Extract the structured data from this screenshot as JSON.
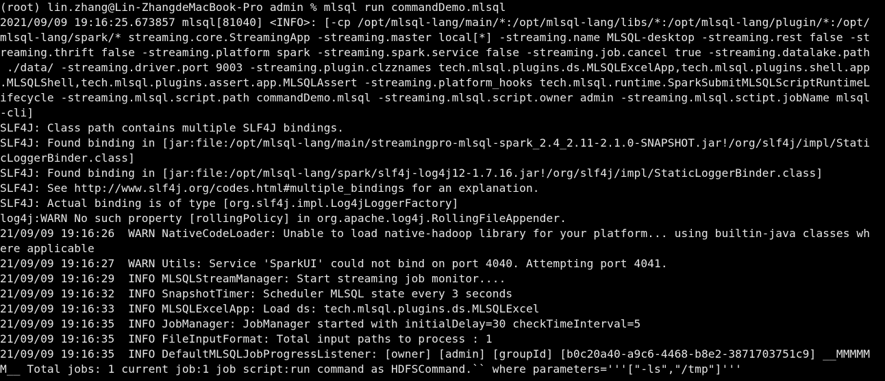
{
  "terminal": {
    "lines": [
      "(root) lin.zhang@Lin-ZhangdeMacBook-Pro admin % mlsql run commandDemo.mlsql",
      "2021/09/09 19:16:25.673857 mlsql[81040] <INFO>: [-cp /opt/mlsql-lang/main/*:/opt/mlsql-lang/libs/*:/opt/mlsql-lang/plugin/*:/opt/",
      "mlsql-lang/spark/* streaming.core.StreamingApp -streaming.master local[*] -streaming.name MLSQL-desktop -streaming.rest false -st",
      "reaming.thrift false -streaming.platform spark -streaming.spark.service false -streaming.job.cancel true -streaming.datalake.path",
      " ./data/ -streaming.driver.port 9003 -streaming.plugin.clzznames tech.mlsql.plugins.ds.MLSQLExcelApp,tech.mlsql.plugins.shell.app",
      ".MLSQLShell,tech.mlsql.plugins.assert.app.MLSQLAssert -streaming.platform_hooks tech.mlsql.runtime.SparkSubmitMLSQLScriptRuntimeL",
      "ifecycle -streaming.mlsql.script.path commandDemo.mlsql -streaming.mlsql.script.owner admin -streaming.mlsql.sctipt.jobName mlsql",
      "-cli]",
      "SLF4J: Class path contains multiple SLF4J bindings.",
      "SLF4J: Found binding in [jar:file:/opt/mlsql-lang/main/streamingpro-mlsql-spark_2.4_2.11-2.1.0-SNAPSHOT.jar!/org/slf4j/impl/Stati",
      "cLoggerBinder.class]",
      "SLF4J: Found binding in [jar:file:/opt/mlsql-lang/spark/slf4j-log4j12-1.7.16.jar!/org/slf4j/impl/StaticLoggerBinder.class]",
      "SLF4J: See http://www.slf4j.org/codes.html#multiple_bindings for an explanation.",
      "SLF4J: Actual binding is of type [org.slf4j.impl.Log4jLoggerFactory]",
      "log4j:WARN No such property [rollingPolicy] in org.apache.log4j.RollingFileAppender.",
      "21/09/09 19:16:26  WARN NativeCodeLoader: Unable to load native-hadoop library for your platform... using builtin-java classes wh",
      "ere applicable",
      "21/09/09 19:16:27  WARN Utils: Service 'SparkUI' could not bind on port 4040. Attempting port 4041.",
      "21/09/09 19:16:29  INFO MLSQLStreamManager: Start streaming job monitor....",
      "21/09/09 19:16:32  INFO SnapshotTimer: Scheduler MLSQL state every 3 seconds",
      "21/09/09 19:16:33  INFO MLSQLExcelApp: Load ds: tech.mlsql.plugins.ds.MLSQLExcel",
      "21/09/09 19:16:35  INFO JobManager: JobManager started with initialDelay=30 checkTimeInterval=5",
      "21/09/09 19:16:35  INFO FileInputFormat: Total input paths to process : 1",
      "21/09/09 19:16:35  INFO DefaultMLSQLJobProgressListener: [owner] [admin] [groupId] [b0c20a40-a9c6-4468-b8e2-3871703751c9] __MMMMM",
      "M__ Total jobs: 1 current job:1 job script:run command as HDFSCommand.`` where parameters='''[\"-ls\",\"/tmp\"]'''",
      ""
    ]
  }
}
